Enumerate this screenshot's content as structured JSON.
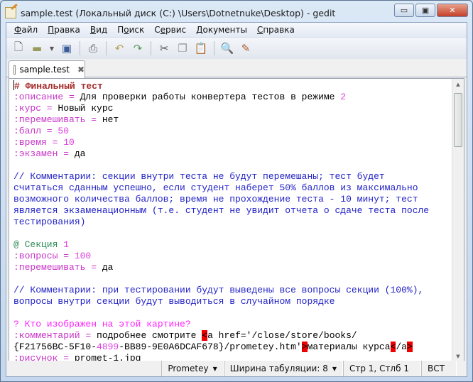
{
  "window": {
    "title": "sample.test (Локальный диск (C:) \\Users\\Dotnetnuke\\Desktop) - gedit",
    "minimize": "▭",
    "maximize": "▣",
    "close": "✕"
  },
  "menu": [
    {
      "u": "Ф",
      "rest": "айл"
    },
    {
      "u": "П",
      "rest": "равка"
    },
    {
      "u": "В",
      "rest": "ид"
    },
    {
      "pre": "П",
      "u": "о",
      "rest": "иск"
    },
    {
      "pre": "С",
      "u": "е",
      "rest": "рвис"
    },
    {
      "u": "Д",
      "rest": "окументы"
    },
    {
      "u": "С",
      "rest": "правка"
    }
  ],
  "toolbar": [
    "new-icon",
    "open-icon",
    "open-dropdown-icon",
    "save-icon",
    "print-icon",
    "undo-icon",
    "redo-icon",
    "cut-icon",
    "copy-icon",
    "paste-icon",
    "find-icon",
    "replace-icon"
  ],
  "tab": {
    "label": "sample.test"
  },
  "lines": [
    [
      [
        "h",
        "# Финальный тест"
      ]
    ],
    [
      [
        "k",
        ":описание = "
      ],
      [
        "",
        "Для проверки работы конвертера тестов в режиме "
      ],
      [
        "n",
        "2"
      ]
    ],
    [
      [
        "k",
        ":курс = "
      ],
      [
        "",
        "Новый курс"
      ]
    ],
    [
      [
        "k",
        ":перемешивать = "
      ],
      [
        "",
        "нет"
      ]
    ],
    [
      [
        "k",
        ":балл = "
      ],
      [
        "n",
        "50"
      ]
    ],
    [
      [
        "k",
        ":время = "
      ],
      [
        "n",
        "10"
      ]
    ],
    [
      [
        "k",
        ":экзамен = "
      ],
      [
        "",
        "да"
      ]
    ],
    [],
    [
      [
        "c",
        "// Комментарии: секции внутри теста не будут перемешаны; тест будет"
      ]
    ],
    [
      [
        "c",
        "считаться сданным успешно, если студент наберет 50% баллов из максимально"
      ]
    ],
    [
      [
        "c",
        "возможного количества баллов; время не прохождение теста - 10 минут; тест"
      ]
    ],
    [
      [
        "c",
        "является экзаменационным (т.е. студент не увидит отчета о сдаче теста после"
      ]
    ],
    [
      [
        "c",
        "тестирования)"
      ]
    ],
    [],
    [
      [
        "s",
        "@ Секция "
      ],
      [
        "n",
        "1"
      ]
    ],
    [
      [
        "k",
        ":вопросы = "
      ],
      [
        "n",
        "100"
      ]
    ],
    [
      [
        "k",
        ":перемешивать = "
      ],
      [
        "",
        "да"
      ]
    ],
    [],
    [
      [
        "c",
        "// Комментарии: при тестировании будут выведены все вопросы секции (100%),"
      ]
    ],
    [
      [
        "c",
        "вопросы внутри секции будут выводиться в случайном порядке"
      ]
    ],
    [],
    [
      [
        "q",
        "? Кто изображен на этой картине?"
      ]
    ],
    [
      [
        "k",
        ":комментарий = "
      ],
      [
        "",
        "подробнее смотрите "
      ],
      [
        "m",
        "<"
      ],
      [
        "",
        "a href='/close/store/books/"
      ]
    ],
    [
      [
        "",
        "{F21756BC-5F10-"
      ],
      [
        "n",
        "4899"
      ],
      [
        "",
        "-BB89-9E0A6DCAF678}/prometey.htm'"
      ],
      [
        "m",
        ">"
      ],
      [
        "",
        "материалы курса"
      ],
      [
        "m",
        "<"
      ],
      [
        "",
        "/a"
      ],
      [
        "m",
        ">"
      ]
    ],
    [
      [
        "k",
        ":рисунок = "
      ],
      [
        "",
        "promet-1.jpg"
      ]
    ]
  ],
  "status": {
    "language": "Prometey",
    "tab_width": "Ширина табуляции: 8",
    "position": "Стр 1, Стлб 1",
    "mode": "ВСТ"
  }
}
